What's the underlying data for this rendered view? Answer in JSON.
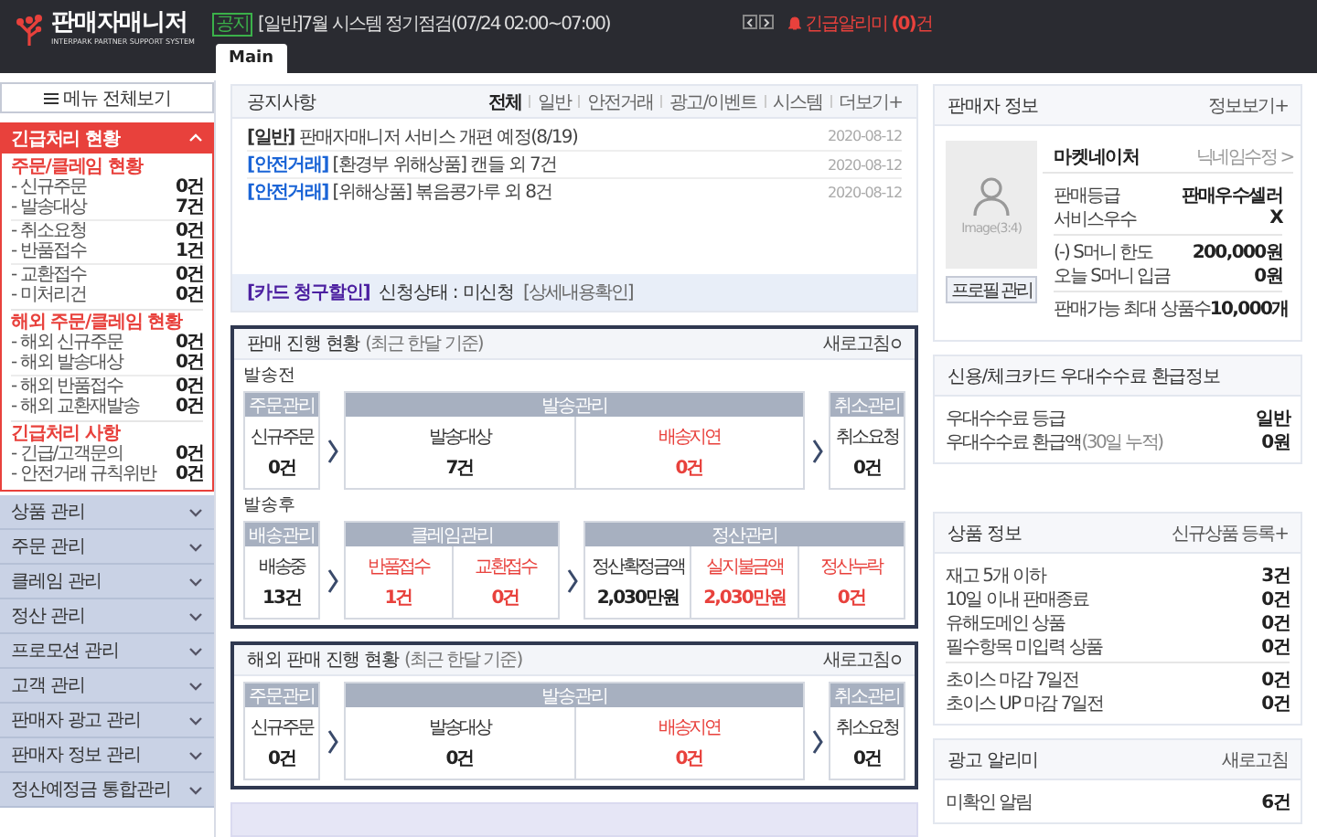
{
  "header": {
    "logo_title": "판매자매니저",
    "logo_subtitle": "INTERPARK PARTNER SUPPORT SYSTEM",
    "notice_badge": "공지",
    "notice_text": "[일반]7월 시스템 정기점검(07/24 02:00~07:00)",
    "alert_label": "긴급알리미 **(0)**건"
  },
  "tabs": [
    {
      "label": "Main",
      "selected": true
    }
  ],
  "sidebar": {
    "menu_all_button": "메뉴 전체보기",
    "urgent": {
      "title": "긴급처리 현황",
      "expanded": true,
      "groups": [
        {
          "title": "주문/클레임 현황",
          "blocks": [
            [
              {
                "label": "- 신규주문",
                "value": "0건"
              },
              {
                "label": "- 발송대상",
                "value": "7건"
              }
            ],
            [
              {
                "label": "- 취소요청",
                "value": "0건"
              },
              {
                "label": "- 반품접수",
                "value": "1건"
              }
            ],
            [
              {
                "label": "- 교환접수",
                "value": "0건"
              },
              {
                "label": "- 미처리건",
                "value": "0건"
              }
            ]
          ]
        },
        {
          "title": "해외 주문/클레임 현황",
          "blocks": [
            [
              {
                "label": "- 해외 신규주문",
                "value": "0건"
              },
              {
                "label": "- 해외 발송대상",
                "value": "0건"
              }
            ],
            [
              {
                "label": "- 해외 반품접수",
                "value": "0건"
              },
              {
                "label": "- 해외 교환재발송",
                "value": "0건"
              }
            ]
          ]
        },
        {
          "title": "긴급처리 사항",
          "blocks": [
            [
              {
                "label": "- 긴급/고객문의",
                "value": "0건"
              },
              {
                "label": "- 안전거래 규칙위반",
                "value": "0건"
              }
            ]
          ]
        }
      ]
    },
    "menu": [
      {
        "label": "상품 관리",
        "expanded": false
      },
      {
        "label": "주문 관리",
        "expanded": false
      },
      {
        "label": "클레임 관리",
        "expanded": false
      },
      {
        "label": "정산 관리",
        "expanded": false
      },
      {
        "label": "프로모션 관리",
        "expanded": false
      },
      {
        "label": "고객 관리",
        "expanded": false
      },
      {
        "label": "판매자 광고 관리",
        "expanded": false
      },
      {
        "label": "판매자 정보 관리",
        "expanded": false
      },
      {
        "label": "정산예정금 통합관리",
        "expanded": false
      }
    ]
  },
  "notices": {
    "title": "공지사항",
    "filters": [
      {
        "label": "전체",
        "selected": true
      },
      {
        "label": "일반",
        "selected": false
      },
      {
        "label": "안전거래",
        "selected": false
      },
      {
        "label": "광고/이벤트",
        "selected": false
      },
      {
        "label": "시스템",
        "selected": false
      }
    ],
    "more": "더보기+",
    "items": [
      {
        "kind": "general",
        "category": "[일반]",
        "text": "판매자매니저 서비스 개편 예정(8/19)",
        "date": "2020-08-12"
      },
      {
        "kind": "safe",
        "category": "[안전거래]",
        "text": "[환경부 위해상품] 캔들 외 7건",
        "date": "2020-08-12"
      },
      {
        "kind": "safe",
        "category": "[안전거래]",
        "text": "[위해상품] 볶음콩가루 외 8건",
        "date": "2020-08-12"
      }
    ],
    "card_tag": "[카드 청구할인]",
    "card_status": "신청상태 : 미신청",
    "card_link": "[상세내용확인]"
  },
  "sales_status": {
    "title": "판매 진행 현황",
    "note": "(최근 한달 기준)",
    "refresh": "새로고침",
    "sections": [
      {
        "label": "발송전",
        "groups": [
          {
            "header": "주문관리",
            "cells": [
              {
                "label": "신규주문",
                "value": "0건",
                "alert": false
              }
            ]
          },
          {
            "header": "발송관리",
            "cells": [
              {
                "label": "발송대상",
                "value": "7건",
                "alert": false
              },
              {
                "label": "배송지연",
                "value": "0건",
                "alert": true
              }
            ]
          },
          {
            "header": "취소관리",
            "cells": [
              {
                "label": "취소요청",
                "value": "0건",
                "alert": false
              }
            ]
          }
        ]
      },
      {
        "label": "발송후",
        "groups": [
          {
            "header": "배송관리",
            "cells": [
              {
                "label": "배송중",
                "value": "13건",
                "alert": false
              }
            ]
          },
          {
            "header": "클레임관리",
            "cells": [
              {
                "label": "반품접수",
                "value": "1건",
                "alert": true
              },
              {
                "label": "교환접수",
                "value": "0건",
                "alert": true
              }
            ]
          },
          {
            "header": "정산관리",
            "cells": [
              {
                "label": "정산확정금액",
                "value": "2,030만원",
                "alert": false
              },
              {
                "label": "실지불금액",
                "value": "2,030만원",
                "alert": true
              },
              {
                "label": "정산누락",
                "value": "0건",
                "alert": true
              }
            ]
          }
        ]
      }
    ]
  },
  "overseas_status": {
    "title": "해외 판매 진행 현황",
    "note": "(최근 한달 기준)",
    "refresh": "새로고침",
    "sections": [
      {
        "groups": [
          {
            "header": "주문관리",
            "cells": [
              {
                "label": "신규주문",
                "value": "0건",
                "alert": false
              }
            ]
          },
          {
            "header": "발송관리",
            "cells": [
              {
                "label": "발송대상",
                "value": "0건",
                "alert": false
              },
              {
                "label": "배송지연",
                "value": "0건",
                "alert": true
              }
            ]
          },
          {
            "header": "취소관리",
            "cells": [
              {
                "label": "취소요청",
                "value": "0건",
                "alert": false
              }
            ]
          }
        ]
      }
    ]
  },
  "seller_info": {
    "title": "판매자 정보",
    "more": "정보보기+",
    "image_label": "Image(3:4)",
    "profile_button": "프로필 관리",
    "name": "마켓네이처",
    "nickname_link": "닉네임수정 >",
    "blocks": [
      [
        {
          "label": "판매등급",
          "value": "판매우수셀러"
        },
        {
          "label": "서비스우수",
          "value": "X"
        }
      ],
      [
        {
          "label": "(-) S머니 한도",
          "value": "200,000원"
        },
        {
          "label": "오늘 S머니 입금",
          "value": "0원"
        }
      ],
      [
        {
          "label": "판매가능 최대 상품수",
          "value": "10,000개"
        }
      ]
    ]
  },
  "card_fee": {
    "title": "신용/체크카드 우대수수료 환급정보",
    "blocks": [
      [
        {
          "label": "우대수수료 등급",
          "value": "일반"
        },
        {
          "label": "우대수수료 환급액",
          "note": "(30일 누적)",
          "value": "0원"
        }
      ]
    ]
  },
  "product_info": {
    "title": "상품 정보",
    "more": "신규상품 등록+",
    "blocks": [
      [
        {
          "label": "재고 5개 이하",
          "value": "3건"
        },
        {
          "label": "10일 이내 판매종료",
          "value": "0건"
        },
        {
          "label": "유해도메인 상품",
          "value": "0건"
        },
        {
          "label": "필수항목 미입력 상품",
          "value": "0건"
        }
      ],
      [
        {
          "label": "초이스 마감 7일전",
          "value": "0건"
        },
        {
          "label": "초이스 UP 마감 7일전",
          "value": "0건"
        }
      ]
    ]
  },
  "ad_alert": {
    "title": "광고 알리미",
    "more": "새로고침",
    "blocks": [
      [
        {
          "label": "미확인 알림",
          "value": "6건"
        }
      ]
    ]
  }
}
